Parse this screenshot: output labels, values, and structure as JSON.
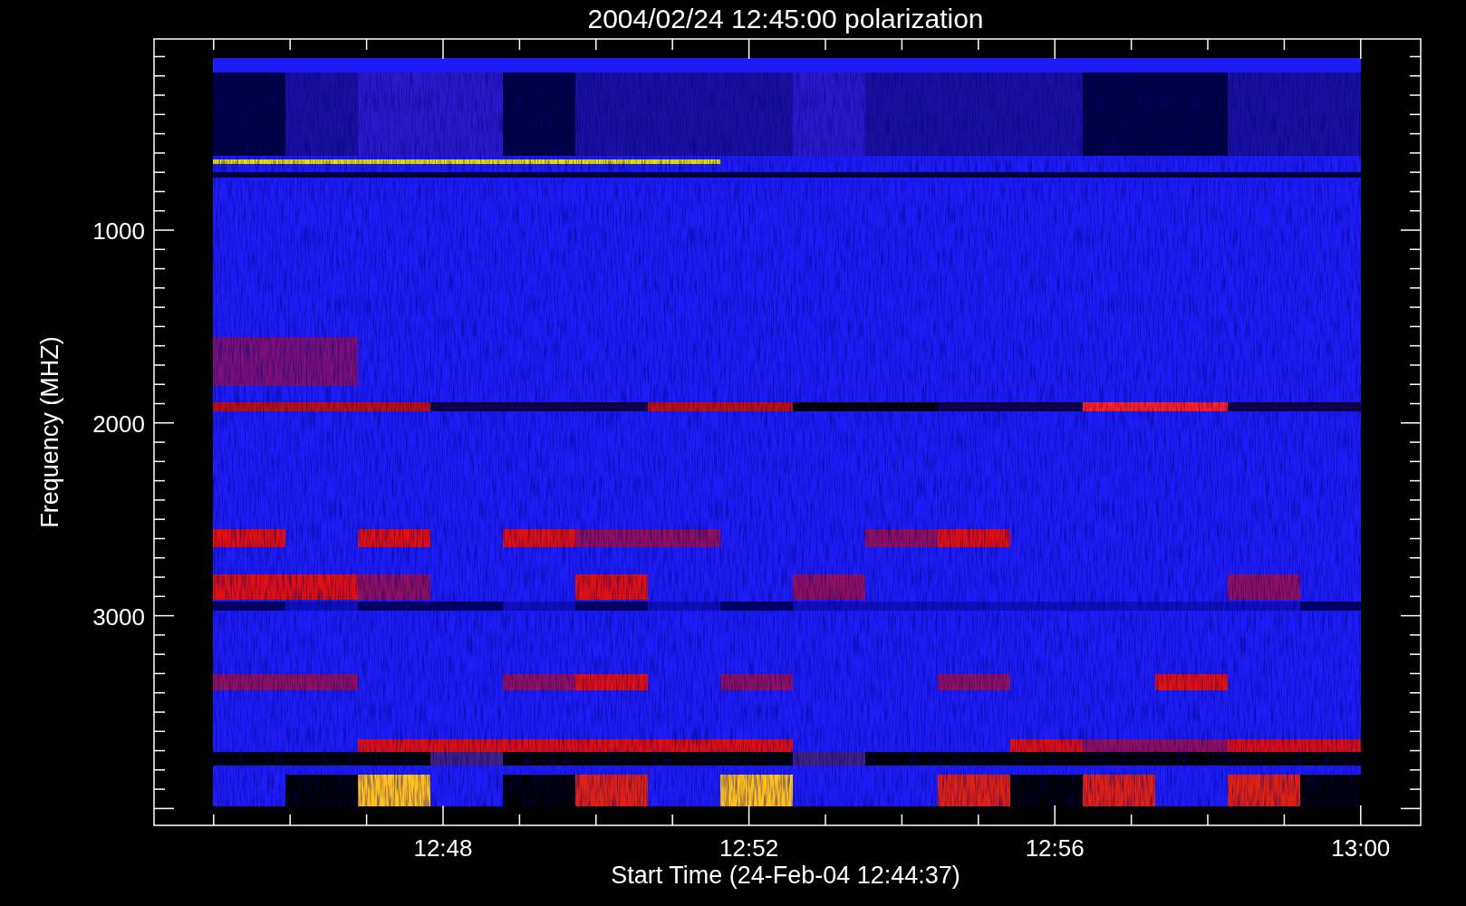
{
  "plot": {
    "title": "2004/02/24 12:45:00 polarization",
    "xlabel": "Start Time (24-Feb-04 12:44:37)",
    "ylabel": "Frequency (MHZ)",
    "xticks": [
      "12:48",
      "12:52",
      "12:56",
      "13:00"
    ],
    "yticks": [
      "1000",
      "2000",
      "3000"
    ]
  }
}
